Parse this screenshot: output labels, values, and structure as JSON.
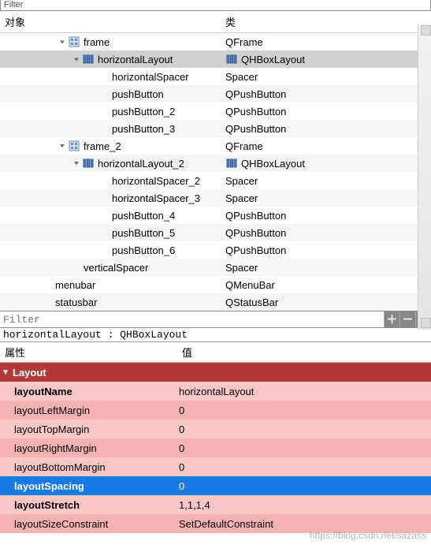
{
  "top_filter_label": "Filter",
  "tree_headers": {
    "object": "对象",
    "class": "类"
  },
  "tree": [
    {
      "depth": 4,
      "exp": "v",
      "icon": "frame",
      "name": "frame",
      "cicon": "",
      "class": "QFrame",
      "alt": false,
      "sel": false
    },
    {
      "depth": 5,
      "exp": "v",
      "icon": "layout",
      "name": "horizontalLayout",
      "cicon": "layout",
      "class": "QHBoxLayout",
      "alt": true,
      "sel": true
    },
    {
      "depth": 6,
      "exp": "",
      "icon": "",
      "name": "horizontalSpacer",
      "cicon": "",
      "class": "Spacer",
      "alt": false,
      "sel": false
    },
    {
      "depth": 6,
      "exp": "",
      "icon": "",
      "name": "pushButton",
      "cicon": "",
      "class": "QPushButton",
      "alt": true,
      "sel": false
    },
    {
      "depth": 6,
      "exp": "",
      "icon": "",
      "name": "pushButton_2",
      "cicon": "",
      "class": "QPushButton",
      "alt": false,
      "sel": false
    },
    {
      "depth": 6,
      "exp": "",
      "icon": "",
      "name": "pushButton_3",
      "cicon": "",
      "class": "QPushButton",
      "alt": true,
      "sel": false
    },
    {
      "depth": 4,
      "exp": "v",
      "icon": "frame",
      "name": "frame_2",
      "cicon": "",
      "class": "QFrame",
      "alt": false,
      "sel": false
    },
    {
      "depth": 5,
      "exp": "v",
      "icon": "layout",
      "name": "horizontalLayout_2",
      "cicon": "layout",
      "class": "QHBoxLayout",
      "alt": true,
      "sel": false
    },
    {
      "depth": 6,
      "exp": "",
      "icon": "",
      "name": "horizontalSpacer_2",
      "cicon": "",
      "class": "Spacer",
      "alt": false,
      "sel": false
    },
    {
      "depth": 6,
      "exp": "",
      "icon": "",
      "name": "horizontalSpacer_3",
      "cicon": "",
      "class": "Spacer",
      "alt": true,
      "sel": false
    },
    {
      "depth": 6,
      "exp": "",
      "icon": "",
      "name": "pushButton_4",
      "cicon": "",
      "class": "QPushButton",
      "alt": false,
      "sel": false
    },
    {
      "depth": 6,
      "exp": "",
      "icon": "",
      "name": "pushButton_5",
      "cicon": "",
      "class": "QPushButton",
      "alt": true,
      "sel": false
    },
    {
      "depth": 6,
      "exp": "",
      "icon": "",
      "name": "pushButton_6",
      "cicon": "",
      "class": "QPushButton",
      "alt": false,
      "sel": false
    },
    {
      "depth": 4,
      "exp": "",
      "icon": "",
      "name": "verticalSpacer",
      "cicon": "",
      "class": "Spacer",
      "alt": true,
      "sel": false
    },
    {
      "depth": 2,
      "exp": "",
      "icon": "",
      "name": "menubar",
      "cicon": "",
      "class": "QMenuBar",
      "alt": false,
      "sel": false
    },
    {
      "depth": 2,
      "exp": "",
      "icon": "",
      "name": "statusbar",
      "cicon": "",
      "class": "QStatusBar",
      "alt": true,
      "sel": false
    }
  ],
  "filter_placeholder": "Filter",
  "breadcrumb": "horizontalLayout : QHBoxLayout",
  "prop_headers": {
    "name": "属性",
    "value": "值"
  },
  "prop_group": "Layout",
  "props": [
    {
      "name": "layoutName",
      "value": "horizontalLayout",
      "bold": true,
      "sel": false,
      "shade": "A"
    },
    {
      "name": "layoutLeftMargin",
      "value": "0",
      "bold": false,
      "sel": false,
      "shade": "B"
    },
    {
      "name": "layoutTopMargin",
      "value": "0",
      "bold": false,
      "sel": false,
      "shade": "A"
    },
    {
      "name": "layoutRightMargin",
      "value": "0",
      "bold": false,
      "sel": false,
      "shade": "B"
    },
    {
      "name": "layoutBottomMargin",
      "value": "0",
      "bold": false,
      "sel": false,
      "shade": "A"
    },
    {
      "name": "layoutSpacing",
      "value": "0",
      "bold": true,
      "sel": true,
      "shade": "B"
    },
    {
      "name": "layoutStretch",
      "value": "1,1,1,4",
      "bold": true,
      "sel": false,
      "shade": "A"
    },
    {
      "name": "layoutSizeConstraint",
      "value": "SetDefaultConstraint",
      "bold": false,
      "sel": false,
      "shade": "B"
    }
  ],
  "watermark": "https://blog.csdn.net/sazass"
}
